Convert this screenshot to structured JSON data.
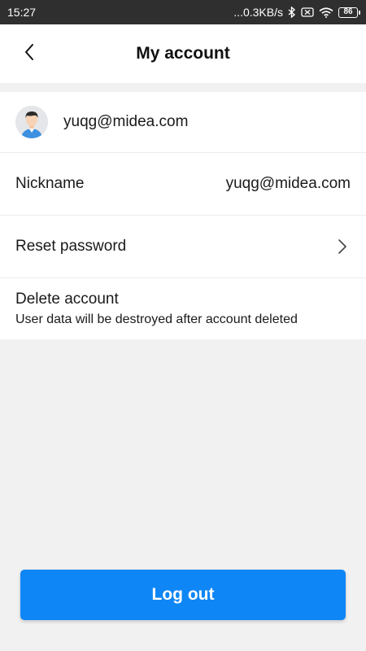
{
  "status_bar": {
    "time": "15:27",
    "network_speed": "...0.3KB/s",
    "battery": "86",
    "icons": [
      "bluetooth-icon",
      "sim-blocked-icon",
      "wifi-icon",
      "battery-icon"
    ]
  },
  "header": {
    "title": "My account",
    "back_icon": "chevron-left-icon"
  },
  "profile": {
    "email": "yuqg@midea.com",
    "avatar_icon": "user-avatar-icon"
  },
  "rows": {
    "nickname": {
      "label": "Nickname",
      "value": "yuqg@midea.com"
    },
    "reset_password": {
      "label": "Reset password",
      "icon": "chevron-right-icon"
    },
    "delete_account": {
      "label": "Delete account",
      "subtitle": "User data will be destroyed after account deleted"
    }
  },
  "logout": {
    "label": "Log out"
  },
  "colors": {
    "primary": "#0f86f5",
    "background": "#f1f1f1",
    "status_bar": "#2f2f2f"
  }
}
